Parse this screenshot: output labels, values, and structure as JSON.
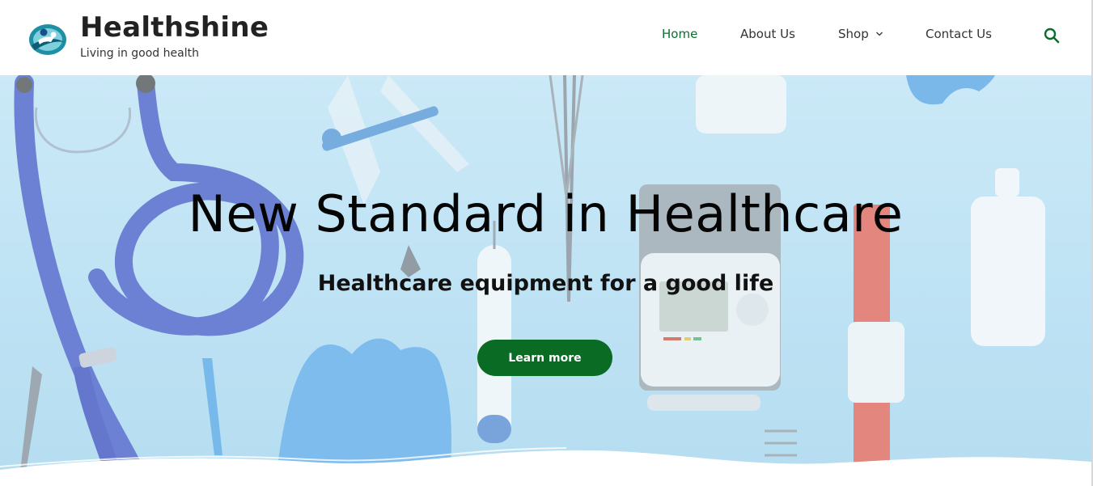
{
  "brand": {
    "title": "Healthshine",
    "tagline": "Living in good health",
    "logo_icon": "healthshine-logo-icon"
  },
  "nav": {
    "items": [
      {
        "label": "Home",
        "active": true
      },
      {
        "label": "About Us",
        "active": false
      },
      {
        "label": "Shop",
        "active": false,
        "has_dropdown": true
      },
      {
        "label": "Contact Us",
        "active": false
      }
    ],
    "search_icon": "search-icon"
  },
  "hero": {
    "heading": "New Standard in Healthcare",
    "subheading": "Healthcare equipment for a good life",
    "cta_label": "Learn more"
  },
  "colors": {
    "accent_green": "#0a6b25",
    "nav_active": "#0d6e2c",
    "hero_background": "#b9e0f3"
  }
}
